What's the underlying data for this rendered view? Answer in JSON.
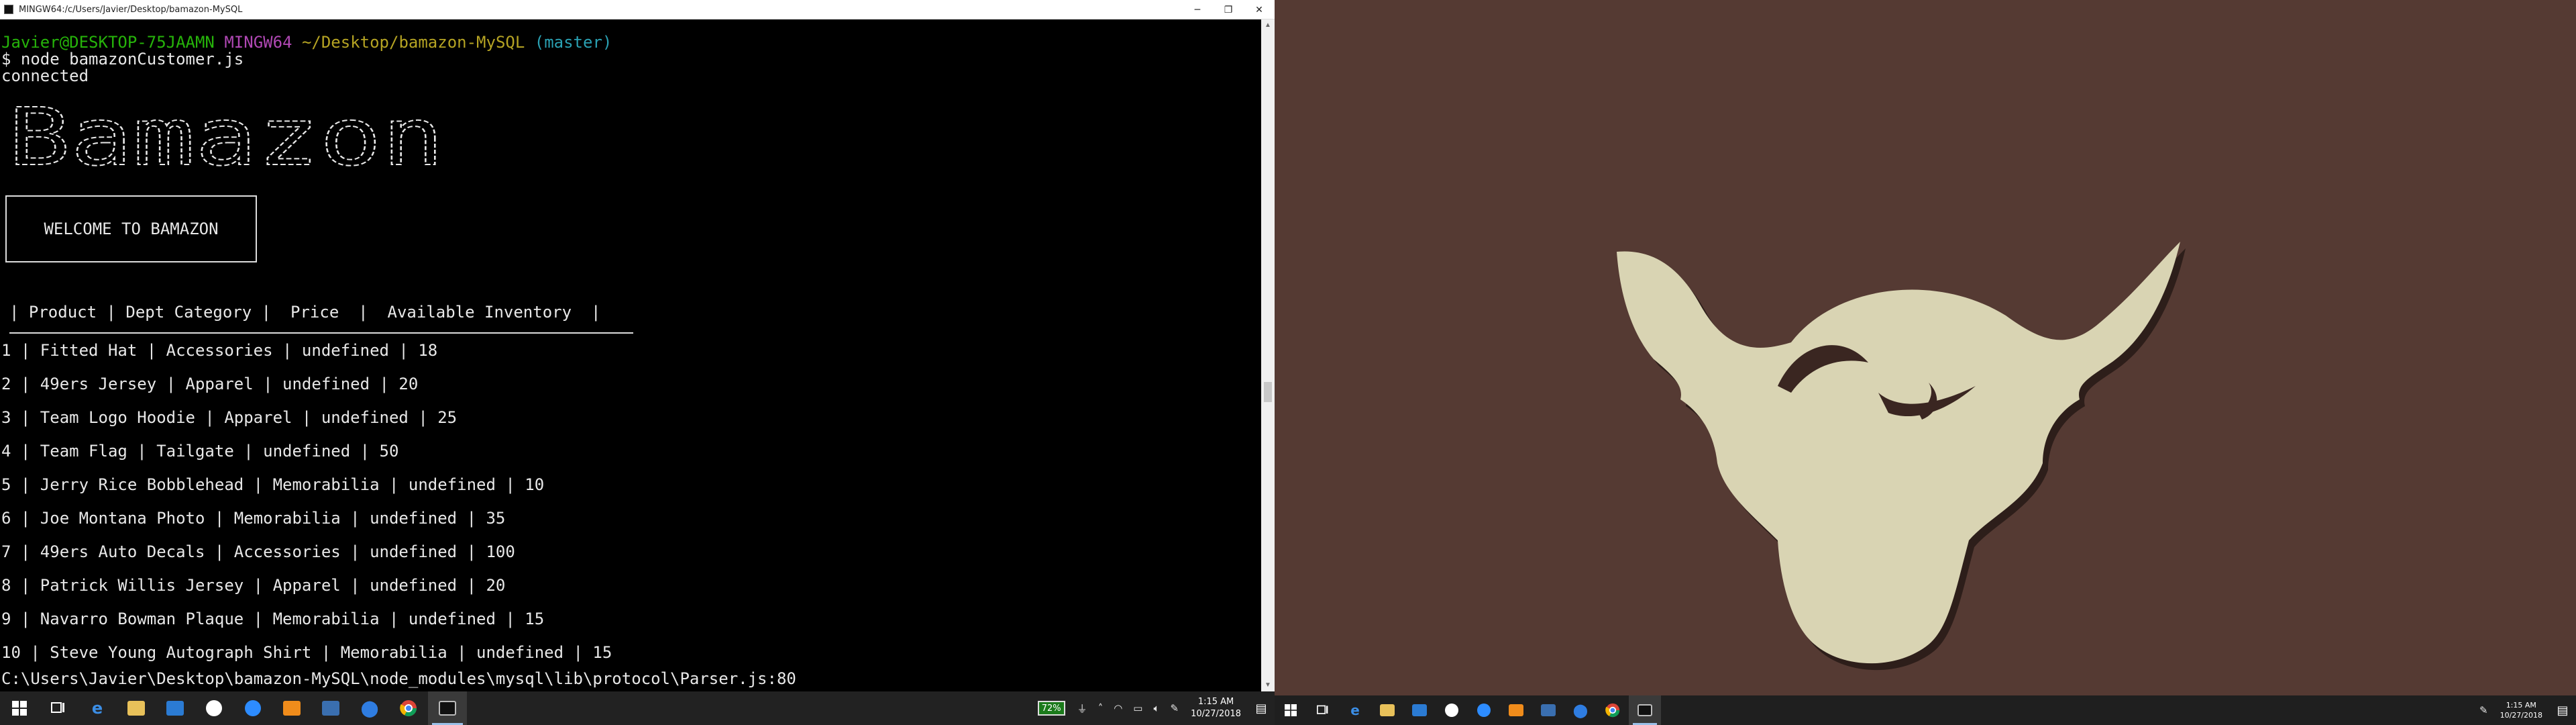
{
  "window": {
    "title": "MINGW64:/c/Users/Javier/Desktop/bamazon-MySQL",
    "minimize": "─",
    "maximize": "❐",
    "close": "✕"
  },
  "prompt": {
    "user_host": "Javier@DESKTOP-75JAAMN",
    "shell": "MINGW64",
    "path": "~/Desktop/bamazon-MySQL",
    "branch": "(master)",
    "command": "$ node bamazonCustomer.js"
  },
  "output": {
    "connected": "connected",
    "banner_art": "Bamazon",
    "welcome": "WELCOME TO BAMAZON",
    "table_header": "| Product | Dept Category |  Price  |  Available Inventory  |",
    "rows": [
      "1 | Fitted Hat | Accessories | undefined | 18",
      "2 | 49ers Jersey | Apparel | undefined | 20",
      "3 | Team Logo Hoodie | Apparel | undefined | 25",
      "4 | Team Flag | Tailgate | undefined | 50",
      "5 | Jerry Rice Bobblehead | Memorabilia | undefined | 10",
      "6 | Joe Montana Photo | Memorabilia | undefined | 35",
      "7 | 49ers Auto Decals | Accessories | undefined | 100",
      "8 | Patrick Willis Jersey | Apparel | undefined | 20",
      "9 | Navarro Bowman Plaque | Memorabilia | undefined | 15",
      "10 | Steve Young Autograph Shirt | Memorabilia | undefined | 15"
    ],
    "error_line": "C:\\Users\\Javier\\Desktop\\bamazon-MySQL\\node_modules\\mysql\\lib\\protocol\\Parser.js:80"
  },
  "colors": {
    "terminal_bg": "#000000",
    "prompt_green": "#26b30a",
    "prompt_purple": "#b048b4",
    "prompt_yellow": "#b5a323",
    "prompt_cyan": "#2aa1b3",
    "wallpaper": "#553a33",
    "logo": "#d9d4b3",
    "taskbar": "#222222"
  },
  "taskbar_left": {
    "apps": [
      {
        "name": "start-button",
        "icon": "windows-logo-icon"
      },
      {
        "name": "task-view-button",
        "icon": "task-view-icon"
      },
      {
        "name": "edge-button",
        "icon": "edge-icon"
      },
      {
        "name": "file-explorer-button",
        "icon": "folder-icon"
      },
      {
        "name": "vscode-button",
        "icon": "vscode-icon"
      },
      {
        "name": "app-s-button",
        "icon": "s-app-icon"
      },
      {
        "name": "zoom-button",
        "icon": "zoom-icon"
      },
      {
        "name": "sublime-button",
        "icon": "sublime-icon"
      },
      {
        "name": "app-blue-button",
        "icon": "blue-app-icon"
      },
      {
        "name": "maps-button",
        "icon": "location-pin-icon"
      },
      {
        "name": "chrome-button",
        "icon": "chrome-icon"
      },
      {
        "name": "terminal-button",
        "icon": "terminal-icon"
      }
    ],
    "battery": "72%",
    "time": "1:15 AM",
    "date": "10/27/2018"
  },
  "taskbar_right": {
    "time": "1:15 AM",
    "date": "10/27/2018"
  }
}
